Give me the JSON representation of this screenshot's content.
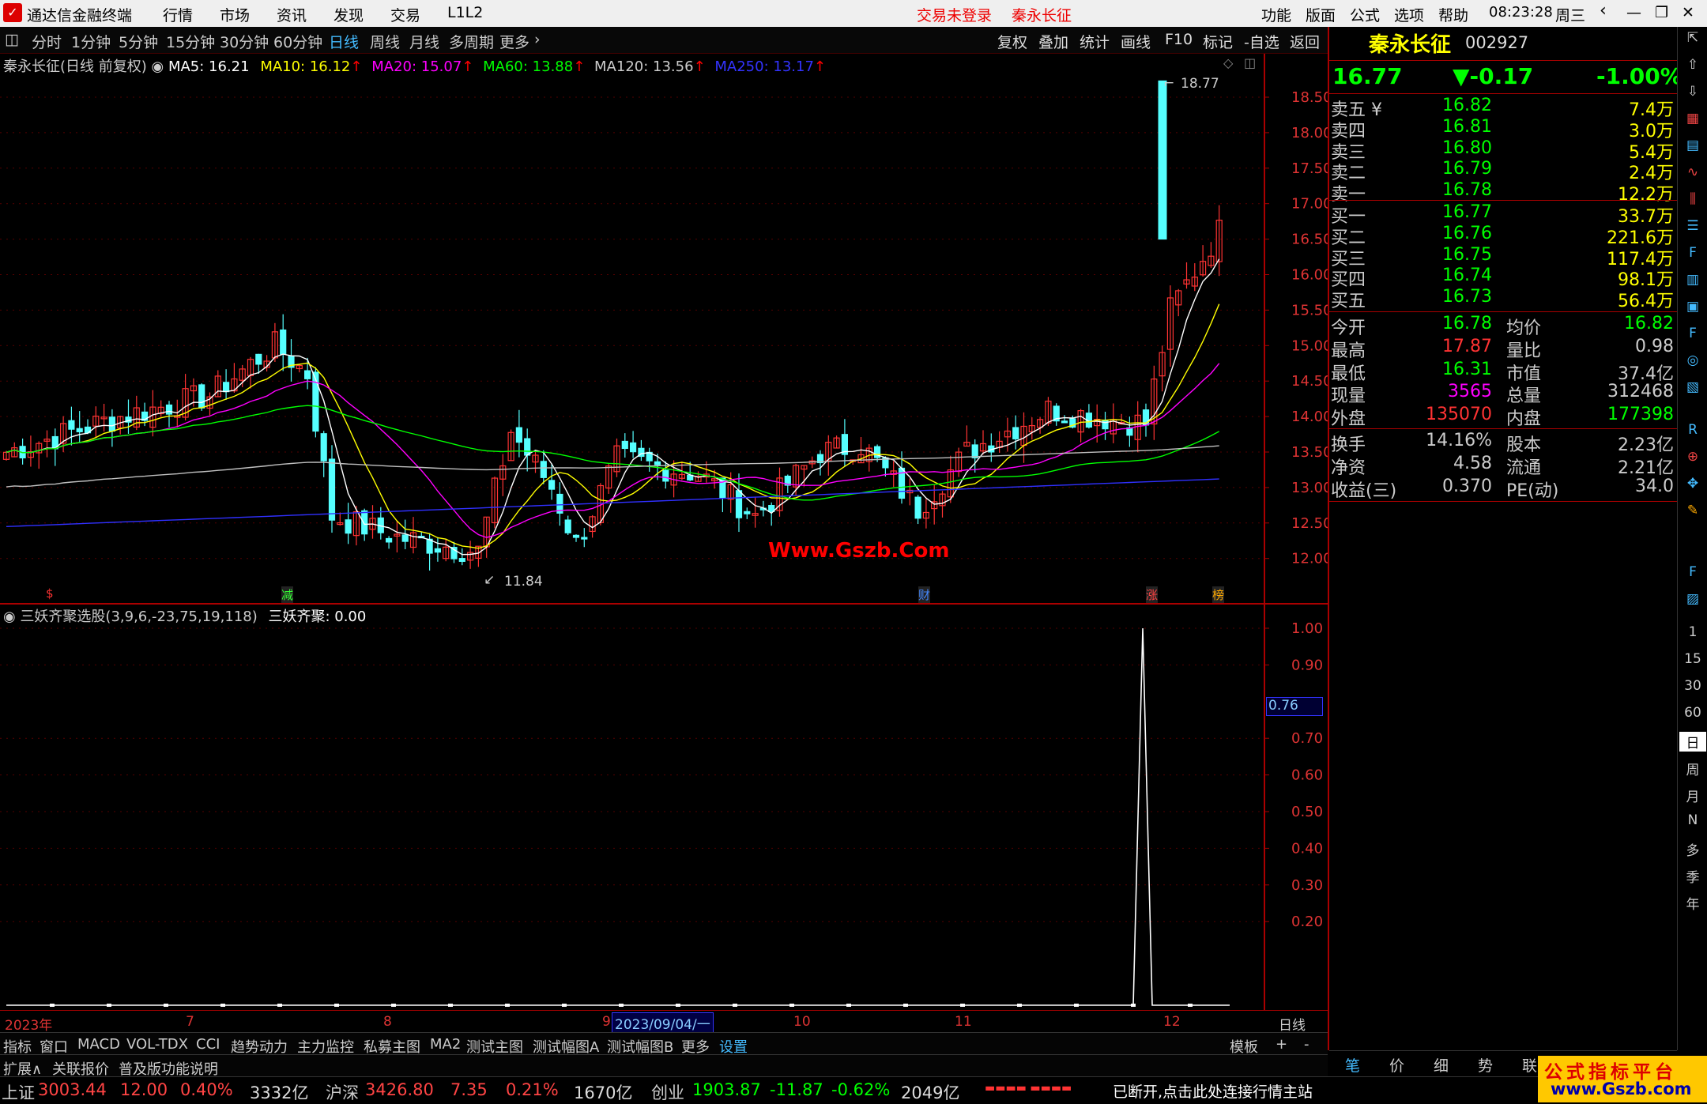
{
  "app": {
    "title": "通达信金融终端",
    "menu": [
      "行情",
      "市场",
      "资讯",
      "发现",
      "交易",
      "L1L2"
    ],
    "login": "交易未登录",
    "stock_header": "秦永长征",
    "right_menu": [
      "功能",
      "版面",
      "公式",
      "选项",
      "帮助"
    ],
    "time": "08:23:28",
    "weekday": "周三"
  },
  "periods": [
    "分时",
    "1分钟",
    "5分钟",
    "15分钟",
    "30分钟",
    "60分钟",
    "日线",
    "周线",
    "月线",
    "多周期",
    "更多"
  ],
  "active_period": "日线",
  "toolbar": [
    "复权",
    "叠加",
    "统计",
    "画线",
    "F10",
    "标记",
    "-自选",
    "返回"
  ],
  "main_title": {
    "name": "秦永长征(日线 前复权)",
    "ma5": "MA5: 16.21",
    "ma10": "MA10: 16.12",
    "ma20": "MA20: 15.07",
    "ma60": "MA60: 13.88",
    "ma120": "MA120: 13.56",
    "ma250": "MA250: 13.17"
  },
  "ma_colors": {
    "ma5": "#ffffff",
    "ma10": "#ffff00",
    "ma20": "#ff00ff",
    "ma60": "#00ff00",
    "ma120": "#c0c0c0",
    "ma250": "#3030ff"
  },
  "price_axis": [
    "18.50",
    "18.00",
    "17.50",
    "17.00",
    "16.50",
    "16.00",
    "15.50",
    "15.00",
    "14.50",
    "14.00",
    "13.50",
    "13.00",
    "12.50",
    "12.00"
  ],
  "high_label": "18.77",
  "low_label": "11.84",
  "watermark": "Www.Gszb.Com",
  "event_marks": [
    "$",
    "减",
    "财",
    "涨",
    "榜"
  ],
  "indicator": {
    "title": "三妖齐聚选股(3,9,6,-23,75,19,118)",
    "value": "三妖齐聚: 0.00",
    "axis": [
      "1.00",
      "0.90",
      "0.70",
      "0.60",
      "0.50",
      "0.40",
      "0.30",
      "0.20"
    ],
    "current": "0.76"
  },
  "time_axis": {
    "labels": [
      "2023年",
      "7",
      "8",
      "9",
      "10",
      "11",
      "12"
    ],
    "cursor": "2023/09/04/一",
    "right": "日线"
  },
  "tabs_row1": [
    "指标",
    "窗口",
    "MACD",
    "VOL-TDX",
    "CCI",
    "趋势动力",
    "主力监控",
    "私募主图",
    "MA2",
    "测试主图",
    "测试幅图A",
    "测试幅图B",
    "更多",
    "设置"
  ],
  "tabs_row1_right": [
    "模板",
    "+",
    "-"
  ],
  "tabs_row2": [
    "扩展∧",
    "关联报价",
    "普及版功能说明"
  ],
  "quote": {
    "name": "秦永长征",
    "code": "002927",
    "price": "16.77",
    "change": "▼-0.17",
    "pct": "-1.00%",
    "asks": [
      [
        "卖五 ¥",
        "16.82",
        "7.4万"
      ],
      [
        "卖四",
        "16.81",
        "3.0万"
      ],
      [
        "卖三",
        "16.80",
        "5.4万"
      ],
      [
        "卖二",
        "16.79",
        "2.4万"
      ],
      [
        "卖一",
        "16.78",
        "12.2万"
      ]
    ],
    "bids": [
      [
        "买一",
        "16.77",
        "33.7万"
      ],
      [
        "买二",
        "16.76",
        "221.6万"
      ],
      [
        "买三",
        "16.75",
        "117.4万"
      ],
      [
        "买四",
        "16.74",
        "98.1万"
      ],
      [
        "买五",
        "16.73",
        "56.4万"
      ]
    ],
    "stats": [
      [
        "今开",
        "16.78",
        "均价",
        "16.82"
      ],
      [
        "最高",
        "17.87",
        "量比",
        "0.98"
      ],
      [
        "最低",
        "16.31",
        "市值",
        "37.4亿"
      ],
      [
        "现量",
        "3565",
        "总量",
        "312468"
      ],
      [
        "外盘",
        "135070",
        "内盘",
        "177398"
      ]
    ],
    "stats2": [
      [
        "换手",
        "14.16%",
        "股本",
        "2.23亿"
      ],
      [
        "净资",
        "4.58",
        "流通",
        "2.21亿"
      ],
      [
        "收益(三)",
        "0.370",
        "PE(动)",
        "34.0"
      ]
    ]
  },
  "right_tabs": [
    "笔",
    "价",
    "细",
    "势",
    "联"
  ],
  "side_tools": [
    "1",
    "15",
    "30",
    "60",
    "日",
    "周",
    "月",
    "N",
    "多",
    "季",
    "年"
  ],
  "status": {
    "sh_label": "上证",
    "sh_val": "3003.44",
    "sh_chg": "12.00",
    "sh_pct": "0.40%",
    "sh_amt": "3332亿",
    "hs_label": "沪深",
    "hs_val": "3426.80",
    "hs_chg": "7.35",
    "hs_pct": "0.21%",
    "hs_amt": "1670亿",
    "cy_label": "创业",
    "cy_val": "1903.87",
    "cy_chg": "-11.87",
    "cy_pct": "-0.62%",
    "cy_amt": "2049亿",
    "conn": "已断开,点击此处连接行情主站"
  },
  "brand": {
    "line1": "公式指标平台",
    "line2": "www.Gszb.com"
  }
}
